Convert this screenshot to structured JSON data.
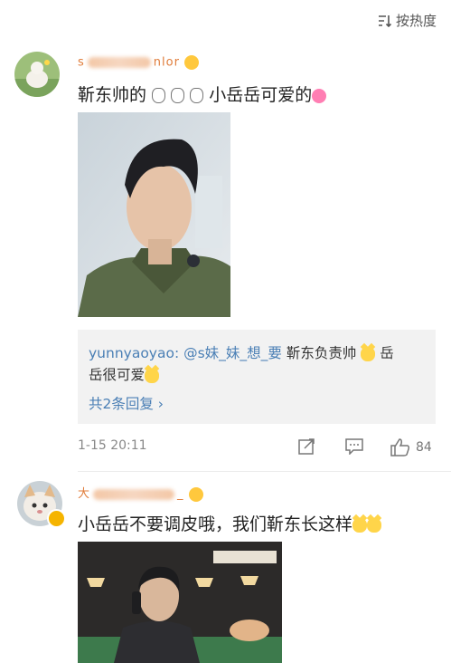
{
  "header": {
    "sort_label": "按热度"
  },
  "comments": [
    {
      "username": "s",
      "username_tail": "nlor",
      "text_main": "靳东帅的",
      "text_after_emojis": "小岳岳可爱的",
      "reply": {
        "handle": "yunnyaoyao: @s妹_妹_想_要",
        "text": "靳东负责帅",
        "text_line2": "岳很可爱",
        "text_end": "岳",
        "more": "共2条回复 ›"
      },
      "timestamp": "1-15 20:11",
      "like_count": "84"
    },
    {
      "username": "大",
      "username_tail": "_",
      "text": "小岳岳不要调皮哦，我们靳东长这样"
    }
  ],
  "colors": {
    "link": "#4a7fb5",
    "muted": "#888888",
    "reply_bg": "#f2f2f2"
  }
}
